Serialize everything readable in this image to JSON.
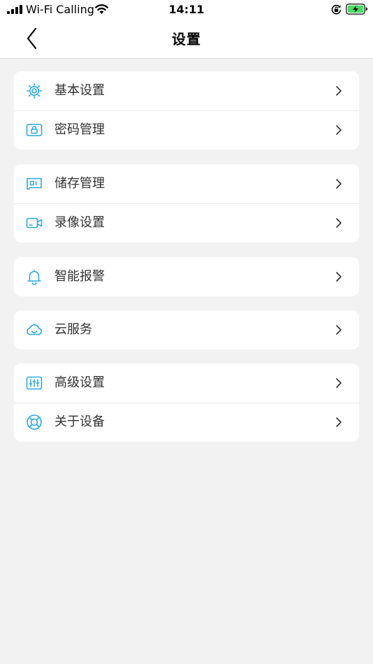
{
  "status_bar": {
    "carrier": "Wi-Fi Calling",
    "time": "14:11"
  },
  "nav": {
    "title": "设置",
    "back_icon": "chevron-left-icon"
  },
  "colors": {
    "accent": "#29a8e0",
    "battery": "#4cd964"
  },
  "groups": [
    {
      "items": [
        {
          "label": "基本设置",
          "icon": "gear-icon"
        },
        {
          "label": "密码管理",
          "icon": "lock-icon"
        }
      ]
    },
    {
      "items": [
        {
          "label": "储存管理",
          "icon": "sd-card-icon"
        },
        {
          "label": "录像设置",
          "icon": "video-camera-icon"
        }
      ]
    },
    {
      "items": [
        {
          "label": "智能报警",
          "icon": "bell-icon"
        }
      ]
    },
    {
      "items": [
        {
          "label": "云服务",
          "icon": "cloud-icon"
        }
      ]
    },
    {
      "items": [
        {
          "label": "高级设置",
          "icon": "sliders-icon"
        },
        {
          "label": "关于设备",
          "icon": "lifebuoy-icon"
        }
      ]
    }
  ]
}
